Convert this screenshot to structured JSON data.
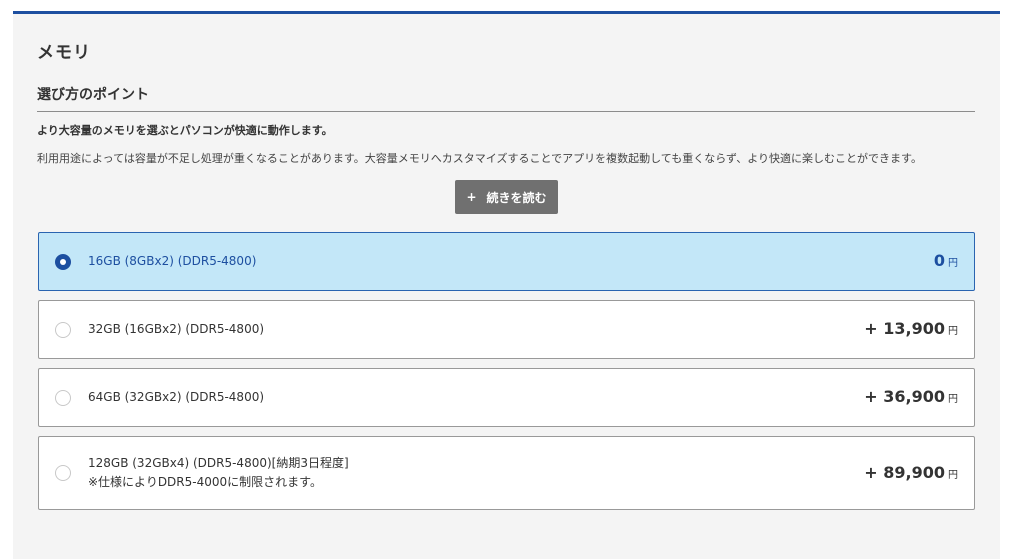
{
  "section": {
    "title": "メモリ"
  },
  "guide": {
    "heading": "選び方のポイント",
    "lead": "より大容量のメモリを選ぶとパソコンが快適に動作します。",
    "description": "利用用途によっては容量が不足し処理が重くなることがあります。大容量メモリへカスタマイズすることでアプリを複数起動しても重くならず、より快適に楽しむことができます。",
    "readmore_icon": "+",
    "readmore_label": "続きを読む"
  },
  "options": [
    {
      "label": "16GB (8GBx2) (DDR5-4800)",
      "note": "",
      "price": "0",
      "unit": "円",
      "selected": true
    },
    {
      "label": "32GB (16GBx2) (DDR5-4800)",
      "note": "",
      "price": "+ 13,900",
      "unit": "円",
      "selected": false
    },
    {
      "label": "64GB (32GBx2) (DDR5-4800)",
      "note": "",
      "price": "+ 36,900",
      "unit": "円",
      "selected": false
    },
    {
      "label": "128GB (32GBx4) (DDR5-4800)[納期3日程度]",
      "note": "※仕様によりDDR5-4000に制限されます。",
      "price": "+ 89,900",
      "unit": "円",
      "selected": false
    }
  ],
  "colors": {
    "accent": "#1d4fa0",
    "selected_bg": "#c3e7f8",
    "panel_bg": "#f4f4f4",
    "button_bg": "#707070"
  }
}
